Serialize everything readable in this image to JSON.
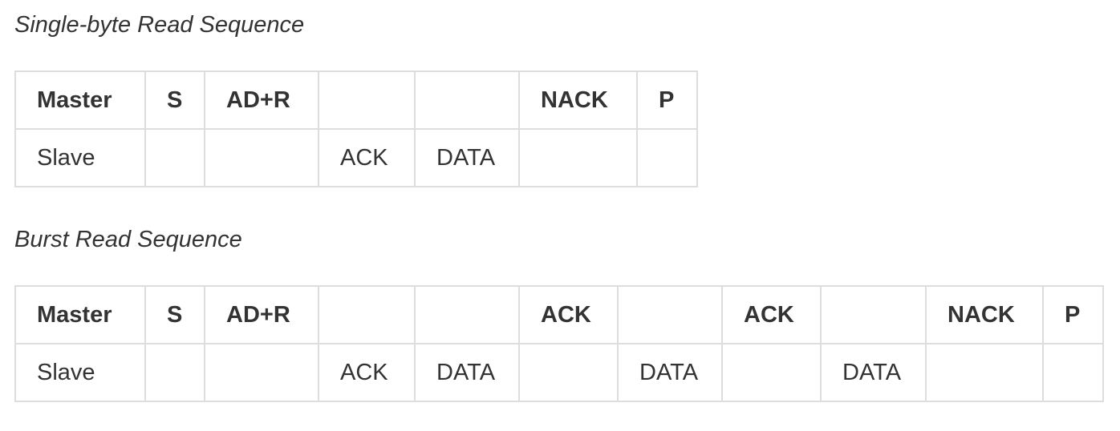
{
  "single_byte": {
    "caption": "Single-byte Read Sequence",
    "master": [
      "Master",
      "S",
      "AD+R",
      "",
      "",
      "NACK",
      "P"
    ],
    "slave": [
      "Slave",
      "",
      "",
      "ACK",
      "DATA",
      "",
      ""
    ]
  },
  "burst": {
    "caption": "Burst Read Sequence",
    "master": [
      "Master",
      "S",
      "AD+R",
      "",
      "",
      "ACK",
      "",
      "ACK",
      "",
      "NACK",
      "P"
    ],
    "slave": [
      "Slave",
      "",
      "",
      "ACK",
      "DATA",
      "",
      "DATA",
      "",
      "DATA",
      "",
      ""
    ]
  },
  "colors": {
    "text": "#333333",
    "border": "#dddddd",
    "background": "#ffffff"
  }
}
